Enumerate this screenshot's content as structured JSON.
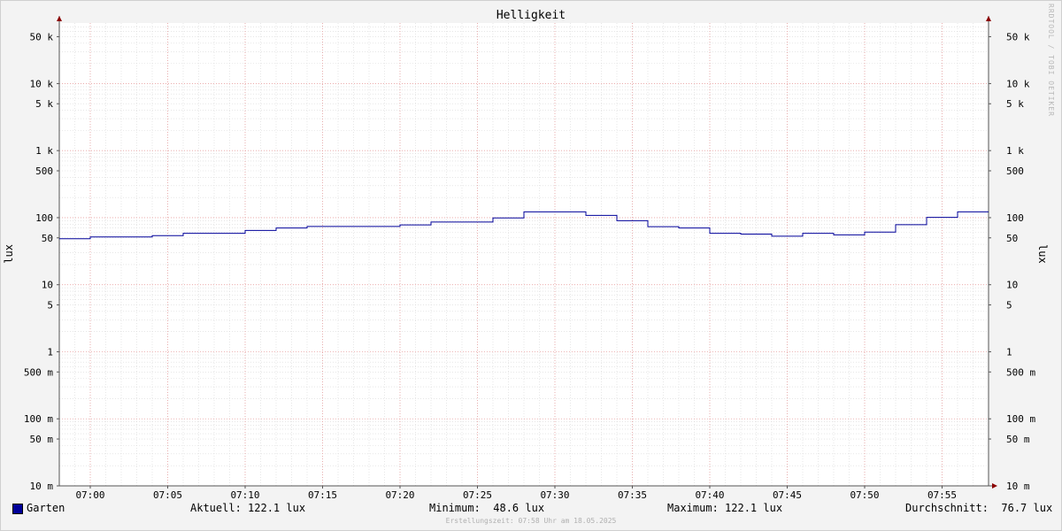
{
  "chart_data": {
    "type": "line",
    "title": "Helligkeit",
    "ylabel": "lux",
    "yscale": "log",
    "ylim": [
      0.01,
      80000
    ],
    "xlim": [
      "06:58",
      "07:58"
    ],
    "y_ticks": [
      {
        "value": 50000,
        "label": "50 k"
      },
      {
        "value": 10000,
        "label": "10 k"
      },
      {
        "value": 5000,
        "label": "5 k"
      },
      {
        "value": 1000,
        "label": "1 k"
      },
      {
        "value": 500,
        "label": "500"
      },
      {
        "value": 100,
        "label": "100"
      },
      {
        "value": 50,
        "label": "50"
      },
      {
        "value": 10,
        "label": "10"
      },
      {
        "value": 5,
        "label": "5"
      },
      {
        "value": 1,
        "label": "1"
      },
      {
        "value": 0.5,
        "label": "500 m"
      },
      {
        "value": 0.1,
        "label": "100 m"
      },
      {
        "value": 0.05,
        "label": "50 m"
      },
      {
        "value": 0.01,
        "label": "10 m"
      }
    ],
    "x_ticks": [
      "07:00",
      "07:05",
      "07:10",
      "07:15",
      "07:20",
      "07:25",
      "07:30",
      "07:35",
      "07:40",
      "07:45",
      "07:50",
      "07:55"
    ],
    "grid": true,
    "legend": "bottom",
    "series": [
      {
        "name": "Garten",
        "color": "#000099",
        "step": "post",
        "x": [
          "06:58",
          "07:00",
          "07:04",
          "07:06",
          "07:10",
          "07:12",
          "07:14",
          "07:20",
          "07:22",
          "07:26",
          "07:28",
          "07:32",
          "07:34",
          "07:36",
          "07:38",
          "07:40",
          "07:42",
          "07:44",
          "07:46",
          "07:48",
          "07:50",
          "07:52",
          "07:54",
          "07:56",
          "07:58"
        ],
        "y": [
          48.6,
          51.5,
          54.0,
          58.5,
          64.5,
          70.0,
          74.0,
          78.0,
          86.0,
          99.0,
          122.0,
          108.0,
          90.0,
          73.5,
          70.0,
          58.5,
          57.0,
          53.0,
          58.5,
          55.5,
          61.0,
          78.5,
          101.0,
          122.1,
          122.1
        ]
      }
    ]
  },
  "legend": {
    "series_name": "Garten",
    "current": "Aktuell: 122.1 lux",
    "minimum": "Minimum:  48.6 lux",
    "maximum": "Maximum: 122.1 lux",
    "average": "Durchschnitt:  76.7 lux"
  },
  "watermark": "RRDTOOL / TOBI OETIKER",
  "footer": "Erstellungszeit: 07:58 Uhr am 18.05.2025"
}
